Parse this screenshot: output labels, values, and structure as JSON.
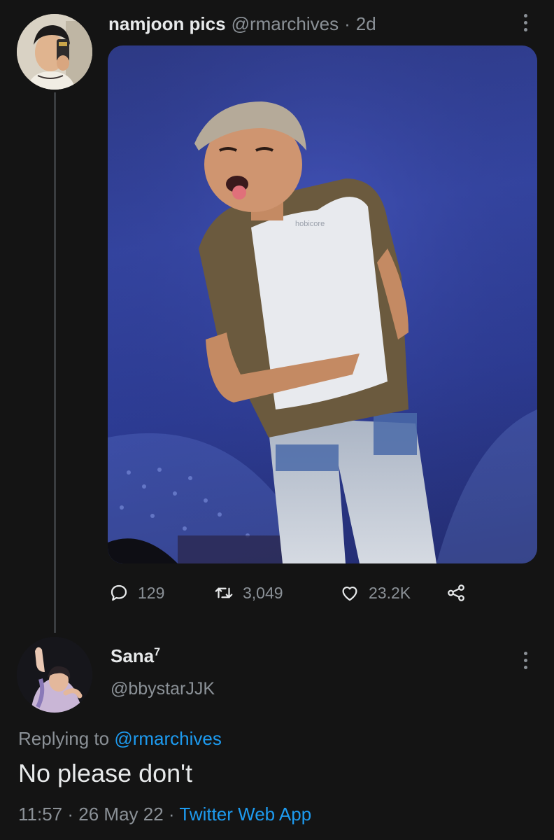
{
  "tweet": {
    "display_name": "namjoon pics",
    "handle": "@rmarchives",
    "separator": "·",
    "time_ago": "2d",
    "media": {
      "watermark": "hobicore"
    },
    "stats": {
      "replies": "129",
      "retweets": "3,049",
      "likes": "23.2K"
    },
    "icons": {
      "reply": "reply-icon",
      "retweet": "retweet-icon",
      "like": "heart-icon",
      "share": "share-icon",
      "more": "more-vertical-icon"
    }
  },
  "reply": {
    "display_name": "Sana",
    "superscript": "7",
    "handle": "@bbystarJJK",
    "replying_prefix": "Replying to",
    "replying_handle": "@rmarchives",
    "text": "No please don't",
    "time": "11:57",
    "separator": "·",
    "date": "26 May 22",
    "separator_2": "·",
    "source": "Twitter Web App"
  },
  "colors": {
    "background": "#141414",
    "text_primary": "#e7e9ea",
    "text_secondary": "#8b9197",
    "link": "#1d9bf0"
  }
}
